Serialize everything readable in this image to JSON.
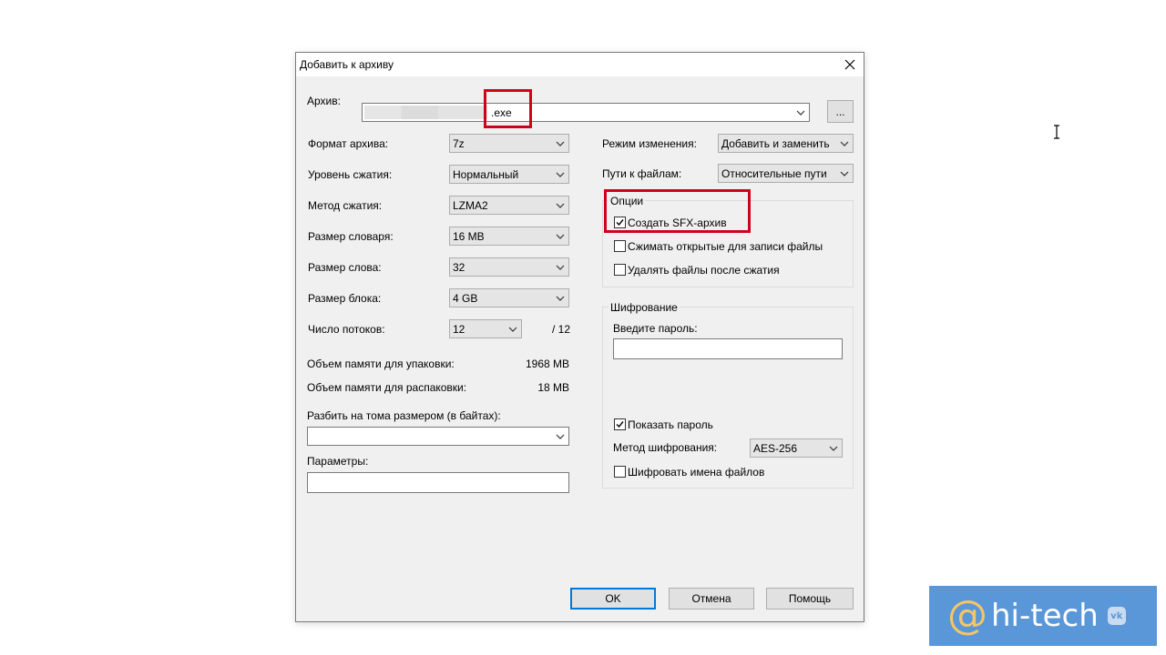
{
  "dialog": {
    "title": "Добавить к архиву",
    "archive": {
      "label": "Архив:",
      "value": ".exe",
      "browse_label": "..."
    },
    "left": {
      "format": {
        "label": "Формат архива:",
        "value": "7z"
      },
      "level": {
        "label": "Уровень сжатия:",
        "value": "Нормальный"
      },
      "method": {
        "label": "Метод сжатия:",
        "value": "LZMA2"
      },
      "dict": {
        "label": "Размер словаря:",
        "value": "16 MB"
      },
      "word": {
        "label": "Размер слова:",
        "value": "32"
      },
      "block": {
        "label": "Размер блока:",
        "value": "4 GB"
      },
      "threads": {
        "label": "Число потоков:",
        "value": "12",
        "max": "/ 12"
      },
      "mem_pack": {
        "label": "Объем памяти для упаковки:",
        "value": "1968 MB"
      },
      "mem_unpack": {
        "label": "Объем памяти для распаковки:",
        "value": "18 MB"
      },
      "split": {
        "label": "Разбить на тома размером (в байтах):",
        "value": ""
      },
      "params": {
        "label": "Параметры:",
        "value": ""
      }
    },
    "right": {
      "update_mode": {
        "label": "Режим изменения:",
        "value": "Добавить и заменить"
      },
      "path_mode": {
        "label": "Пути к файлам:",
        "value": "Относительные пути"
      },
      "options": {
        "title": "Опции",
        "sfx": {
          "label": "Создать SFX-архив",
          "checked": true
        },
        "shared": {
          "label": "Сжимать открытые для записи файлы",
          "checked": false
        },
        "delete": {
          "label": "Удалять файлы после сжатия",
          "checked": false
        }
      },
      "encryption": {
        "title": "Шифрование",
        "password_label": "Введите пароль:",
        "password_value": "",
        "show_password": {
          "label": "Показать пароль",
          "checked": true
        },
        "method_label": "Метод шифрования:",
        "method_value": "AES-256",
        "encrypt_names": {
          "label": "Шифровать имена файлов",
          "checked": false
        }
      }
    },
    "buttons": {
      "ok": "OK",
      "cancel": "Отмена",
      "help": "Помощь"
    }
  },
  "watermark": {
    "brand": "hi-tech",
    "at": "@",
    "vk": "vk"
  },
  "colors": {
    "highlight": "#d0021b",
    "dialog_bg": "#f0f0f0",
    "default_button_border": "#0078d7"
  }
}
